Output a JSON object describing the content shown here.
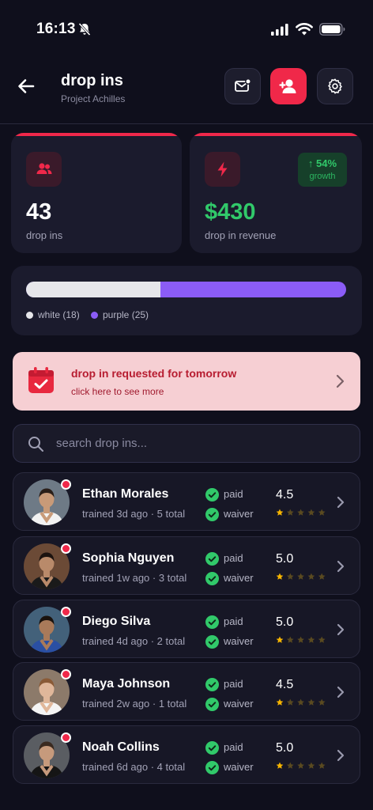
{
  "status_bar": {
    "time": "16:13"
  },
  "header": {
    "title": "drop ins",
    "subtitle": "Project Achilles"
  },
  "stats": {
    "count_value": "43",
    "count_label": "drop ins",
    "revenue_value": "$430",
    "revenue_label": "drop in revenue",
    "growth_pct": "↑ 54%",
    "growth_label": "growth"
  },
  "belts": {
    "white_label": "white (18)",
    "purple_label": "purple (25)",
    "white_count": 18,
    "purple_count": 25
  },
  "alert": {
    "title": "drop in requested for tomorrow",
    "subtitle": "click here to see more"
  },
  "search": {
    "placeholder": "search drop ins..."
  },
  "people": [
    {
      "name": "Ethan Morales",
      "meta": "trained 3d ago · 5 total",
      "paid": "paid",
      "waiver": "waiver",
      "rating": "4.5",
      "rating_value": 4.5
    },
    {
      "name": "Sophia Nguyen",
      "meta": "trained 1w ago · 3 total",
      "paid": "paid",
      "waiver": "waiver",
      "rating": "5.0",
      "rating_value": 5.0
    },
    {
      "name": "Diego Silva",
      "meta": "trained 4d ago · 2 total",
      "paid": "paid",
      "waiver": "waiver",
      "rating": "5.0",
      "rating_value": 5.0
    },
    {
      "name": "Maya Johnson",
      "meta": "trained 2w ago · 1 total",
      "paid": "paid",
      "waiver": "waiver",
      "rating": "4.5",
      "rating_value": 4.5
    },
    {
      "name": "Noah Collins",
      "meta": "trained 6d ago · 4 total",
      "paid": "paid",
      "waiver": "waiver",
      "rating": "5.0",
      "rating_value": 5.0
    }
  ],
  "colors": {
    "accent": "#f0284a",
    "success": "#31c96a",
    "purple": "#8b5cf6",
    "star": "#f7b500",
    "background": "#0f0f1c"
  }
}
